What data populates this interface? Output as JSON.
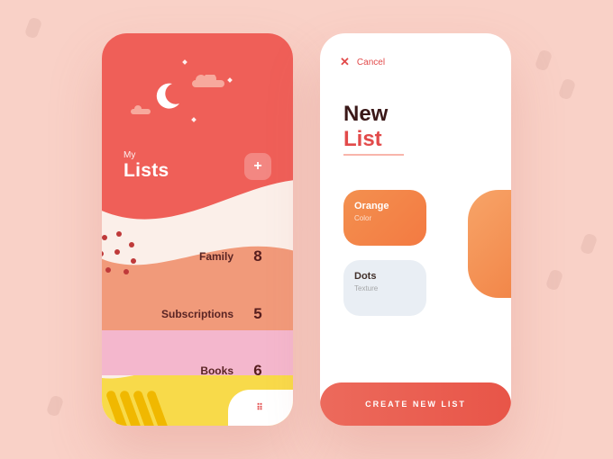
{
  "left": {
    "header_small": "My",
    "header_title": "Lists",
    "add_symbol": "+",
    "bottom_glyph": "⠿",
    "rows": [
      {
        "name": "Family",
        "count": "8"
      },
      {
        "name": "Subscriptions",
        "count": "5"
      },
      {
        "name": "Books",
        "count": "6"
      }
    ]
  },
  "right": {
    "cancel_label": "Cancel",
    "cancel_symbol": "✕",
    "title_line1": "New",
    "title_line2": "List",
    "option_color": {
      "title": "Orange",
      "subtitle": "Color"
    },
    "option_texture": {
      "title": "Dots",
      "subtitle": "Texture"
    },
    "create_label": "CREATE NEW LIST"
  },
  "colors": {
    "bg": "#f9d1c7",
    "red": "#ee5b54",
    "orange": "#f3904f",
    "pink": "#f4b7cd",
    "yellow": "#f8da4a"
  }
}
